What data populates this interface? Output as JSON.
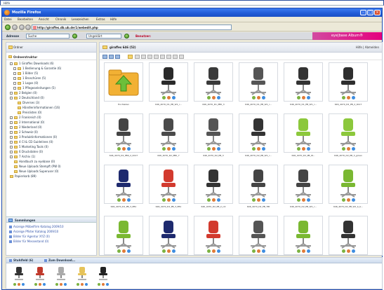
{
  "helpbar": {
    "label": "Hilfe"
  },
  "window": {
    "title": "Mozilla Firefox"
  },
  "menubar": {
    "items": [
      "Datei",
      "Bearbeiten",
      "Ansicht",
      "Chronik",
      "Lesezeichen",
      "Extras",
      "Hilfe"
    ]
  },
  "navbar": {
    "url": "http://giraffes.db.ub.de/1/webedit.php"
  },
  "toolbar2": {
    "adresse_label": "Adresse",
    "suche_label": "Suche",
    "sel_label": "Ungeklärt",
    "benutzer_label": "Benutzer:"
  },
  "brand": {
    "text": "eye|base Album®"
  },
  "leftpanel": {
    "header": "Ordner",
    "section": "Ordnerstruktur",
    "tree": [
      "1 Giraffes Downloads (6)",
      "1 Bedienung & Garantie (6)",
      "1 Bilder (5)",
      "1 Broschüren (5)",
      "1 Logos (0)",
      "1 Pflegeanleitungen (5)",
      "2 Belgien (0)",
      "2 Deutschland (0)",
      "Diverses (3)",
      "Händlerinformationen (16)",
      "Preislisten (0)",
      "2 Frankreich (0)",
      "2 International (0)",
      "2 Niederland (0)",
      "2 Schweiz (0)",
      "3 Produktinformationen (0)",
      "4 CI & CD Guidelines (0)",
      "5 Marketing Tools (0)",
      "6 Druckdaten (0)",
      "7 Archiv (1)",
      "Handbuch zu eyebase (0)",
      "Neue Uploads Stempft (PW 0)",
      "Neue Uploads Superuser (0)",
      "Papierkorb (89)"
    ],
    "sammlungen": {
      "header": "Sammlungen",
      "items": [
        "Anzeige Möbelfirm Katalog 2009/10",
        "Anzeige Pfister Katalog 2009/10",
        "Bilder für Agentur XYZ (0)",
        "Bilder für Messestand (0)"
      ]
    }
  },
  "mainpanel": {
    "title": "giraffes 646 (52)",
    "login": "Hilfe | Abmelden",
    "cards": [
      {
        "label": "Hochladen"
      },
      {
        "label": "646_4070_D1_PB_W1_r..."
      },
      {
        "label": "646_4070_D1_PB0_3"
      },
      {
        "label": "646_4070_D1_PB_W1_r..."
      },
      {
        "label": "646_4070_D1_PB_W1_r..."
      },
      {
        "label": "646_4070_D2_PB_2_0017"
      },
      {
        "label": "646_4070_D2_PB0_2_0017"
      },
      {
        "label": "646_4070_D2_PB0_7"
      },
      {
        "label": "646_4070_D2_PB_3"
      },
      {
        "label": "646_4070_D2_PB_W1_r..."
      },
      {
        "label": "646_4070_D2_PB_W..."
      },
      {
        "label": "646_4070_D2_PB_3_grüen"
      },
      {
        "label": "646_4070_D2_PB_3_PB1"
      },
      {
        "label": "646_4070_D2_PB_3_PB1"
      },
      {
        "label": "646_4070_D2_PB_2_rot"
      },
      {
        "label": "646_4070_D2_PB_TIB"
      },
      {
        "label": "646_4070_D2_PB_W1_r..."
      },
      {
        "label": "646_4070_D2_PB_W1_b_b..."
      },
      {
        "label": ""
      },
      {
        "label": ""
      },
      {
        "label": ""
      },
      {
        "label": ""
      },
      {
        "label": ""
      },
      {
        "label": ""
      }
    ]
  },
  "tray": {
    "tab1": "Stuhlfeld (6)",
    "tab2": "Zum Download..."
  },
  "icons": [
    "firefox-icon",
    "folder-icon",
    "upload-icon",
    "chair-icon",
    "collection-icon",
    "minimize-icon",
    "maximize-icon",
    "close-icon",
    "back-icon",
    "forward-icon",
    "reload-icon",
    "home-icon"
  ],
  "colors": {
    "accent": "#1f5ad6",
    "brand": "#e4007e",
    "link": "#3355aa"
  }
}
